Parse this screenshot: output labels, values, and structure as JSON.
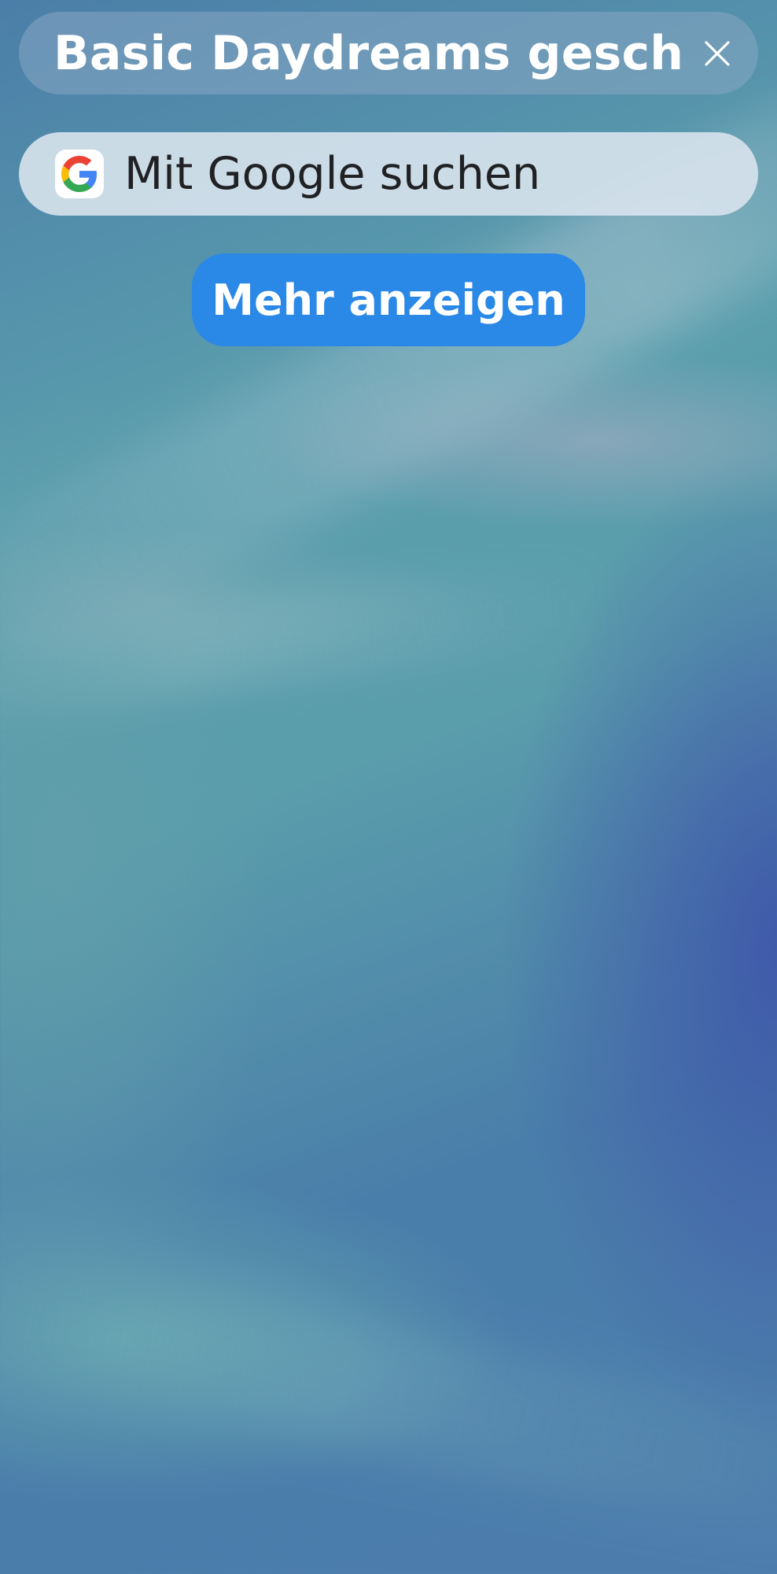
{
  "notification": {
    "text": "Basic Daydreams geschloss",
    "close_icon": "close-icon"
  },
  "search": {
    "placeholder": "Mit Google suchen",
    "logo_icon": "google-g-icon",
    "logo_colors": {
      "blue": "#4285F4",
      "red": "#EA4335",
      "yellow": "#FBBC05",
      "green": "#34A853"
    }
  },
  "actions": {
    "more_label": "Mehr anzeigen",
    "more_color": "#2a88e6"
  }
}
